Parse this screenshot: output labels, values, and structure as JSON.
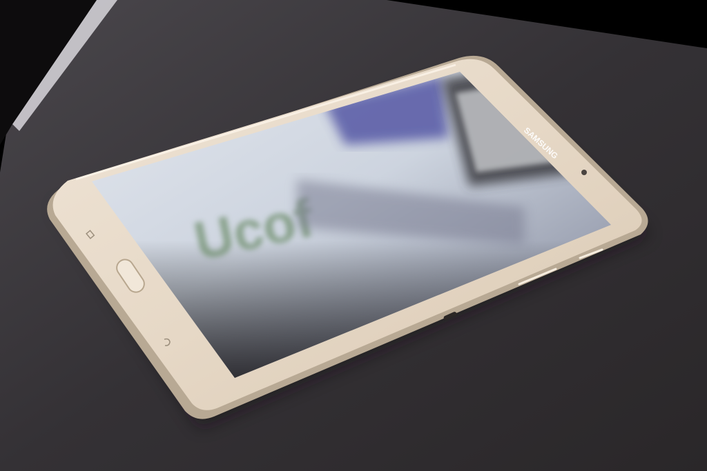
{
  "scene": {
    "description_colors": {
      "background": "#000000",
      "table": "#2f2c2e",
      "tablet_bezel": "#e9dccb",
      "tablet_edge": "#c9b9a3",
      "screen_glass": "#cdd6e2"
    },
    "device": {
      "brand": "SAMSUNG"
    },
    "screen_reflection": {
      "blurred_text": "Ucof"
    }
  }
}
